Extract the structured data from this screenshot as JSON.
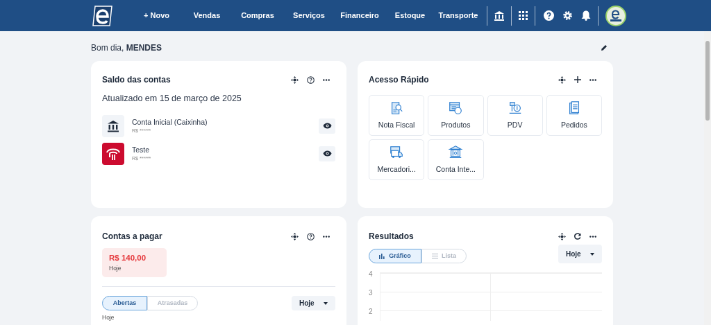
{
  "nav": {
    "items": [
      "+ Novo",
      "Vendas",
      "Compras",
      "Serviços",
      "Financeiro",
      "Estoque",
      "Transporte"
    ]
  },
  "greeting": "Bom dia, **MENDES**",
  "saldo": {
    "title": "Saldo das contas",
    "updated": "Atualizado em 15 de março de 2025",
    "accounts": [
      {
        "kind": "bank",
        "name": "Conta Inicial (Caixinha)",
        "balance": "R$ ******"
      },
      {
        "kind": "brand",
        "name": "Teste",
        "balance": "R$ ******"
      }
    ]
  },
  "acesso": {
    "title": "Acesso Rápido",
    "tiles": [
      {
        "kind": "invoice",
        "label": "Nota Fiscal"
      },
      {
        "kind": "products",
        "label": "Produtos"
      },
      {
        "kind": "pos",
        "label": "PDV"
      },
      {
        "kind": "orders",
        "label": "Pedidos"
      },
      {
        "kind": "truck",
        "label": "Mercadori..."
      },
      {
        "kind": "bank",
        "label": "Conta Inte..."
      }
    ]
  },
  "pagar": {
    "title": "Contas a pagar",
    "amount": "R$ 140,00",
    "amount_caption": "Hoje",
    "tabs": [
      {
        "label": "Abertas",
        "selected": true
      },
      {
        "label": "Atrasadas",
        "selected": false
      }
    ],
    "period": "Hoje",
    "section": "Hoje"
  },
  "resultados": {
    "title": "Resultados",
    "tabs": [
      {
        "kind": "chart",
        "label": "Gráfico",
        "selected": true
      },
      {
        "kind": "list",
        "label": "Lista",
        "selected": false
      }
    ],
    "period": "Hoje",
    "yticks": [
      "4",
      "3",
      "2"
    ]
  }
}
